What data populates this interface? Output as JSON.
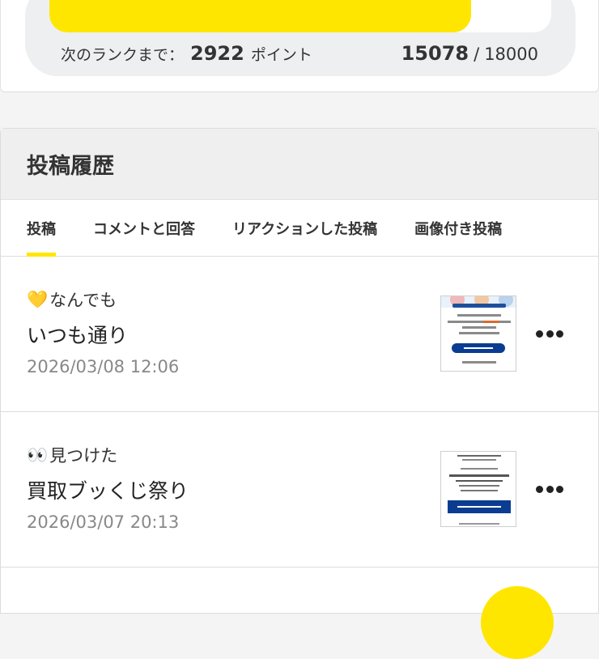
{
  "rank": {
    "progress_fraction": 0.84,
    "next_label": "次のランクまで：",
    "next_points": "2922",
    "points_unit": "ポイント",
    "current": "15078",
    "separator": "/",
    "max": "18000"
  },
  "history": {
    "title": "投稿履歴",
    "tabs": [
      {
        "label": "投稿",
        "active": true
      },
      {
        "label": "コメントと回答",
        "active": false
      },
      {
        "label": "リアクションした投稿",
        "active": false
      },
      {
        "label": "画像付き投稿",
        "active": false
      }
    ],
    "posts": [
      {
        "category_emoji": "💛",
        "category": "なんでも",
        "title": "いつも通り",
        "date": "2026/03/08 12:06",
        "thumb_button": "クーポンを獲得する"
      },
      {
        "category_emoji": "👀",
        "category": "見つけた",
        "title": "買取ブッくじ祭り",
        "date": "2026/03/07 20:13",
        "thumb_button": "[指定ページ] へアクセス"
      }
    ]
  },
  "colors": {
    "accent": "#ffe600",
    "thumb_button": "#0a3d91"
  },
  "icons": [
    "more-icon",
    "heart-emoji-icon",
    "eyes-emoji-icon"
  ]
}
